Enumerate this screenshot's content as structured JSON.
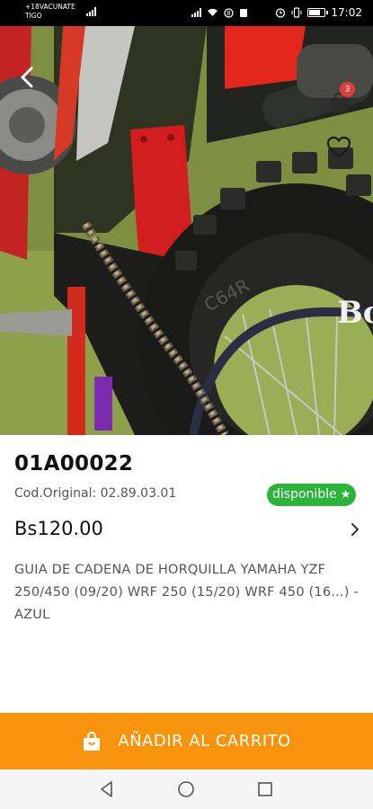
{
  "status_bar": {
    "carrier_line1": "+18VACUNATE",
    "carrier_line2": "TIGO",
    "time": "17:02"
  },
  "hero": {
    "cart_count": "3",
    "tire_brand_text": "C64R",
    "tire_logo_text": "Bo"
  },
  "product": {
    "code": "01A00022",
    "original_code": "Cod.Original: 02.89.03.01",
    "status": "disponible",
    "price": "Bs120.00",
    "description": "GUIA DE CADENA DE HORQUILLA YAMAHA YZF 250/450 (09/20) WRF 250 (15/20) WRF 450 (16...) - AZUL"
  },
  "actions": {
    "add_to_cart": "AÑADIR AL CARRITO"
  },
  "colors": {
    "accent": "#f7930d",
    "available": "#2bb33a",
    "badge": "#e23b3b"
  },
  "icons": [
    "back-arrow-icon",
    "cart-icon",
    "heart-icon",
    "star-icon",
    "chevron-right-icon",
    "shopping-bag-icon",
    "nav-back-icon",
    "nav-home-icon",
    "nav-recents-icon"
  ]
}
